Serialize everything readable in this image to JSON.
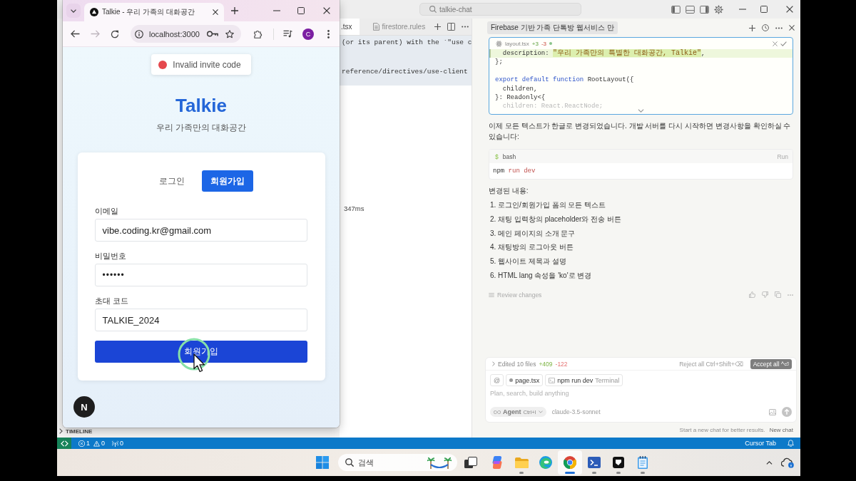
{
  "ide": {
    "command_center": {
      "label": "talkie-chat"
    },
    "sidebar": {
      "sections": [
        {
          "label": "TIMELINE",
          "expanded": false
        }
      ]
    },
    "editor": {
      "tabs": [
        {
          "label": ".tsx",
          "selected": true
        },
        {
          "label": "firestore.rules",
          "selected": false
        }
      ],
      "lines": [
        "(or its parent) with the `\"use c",
        "reference/directives/use-client"
      ],
      "timing": "347ms"
    },
    "chat": {
      "title": "Firebase 기반 가족 단톡방 웹서비스 만",
      "code_card": {
        "file": "layout.tsx",
        "added": "+3",
        "removed": "-3",
        "lines": [
          {
            "kind": "added",
            "tokens": [
              {
                "text": "  description: ",
                "kind": "plain"
              },
              {
                "text": "\"우리 가족만의 특별한 대화공간, Talkie\"",
                "kind": "string"
              },
              {
                "text": ",",
                "kind": "plain"
              }
            ]
          },
          {
            "kind": "context",
            "tokens": [
              {
                "text": "};",
                "kind": "plain"
              }
            ]
          },
          {
            "kind": "blank"
          },
          {
            "kind": "context",
            "tokens": [
              {
                "text": "export default function",
                "kind": "keyword"
              },
              {
                "text": " RootLayout({",
                "kind": "plain"
              }
            ]
          },
          {
            "kind": "context",
            "tokens": [
              {
                "text": "  children,",
                "kind": "plain"
              }
            ]
          },
          {
            "kind": "context",
            "tokens": [
              {
                "text": "}: Readonly<{",
                "kind": "plain"
              }
            ]
          },
          {
            "kind": "context",
            "tokens": [
              {
                "text": "  children: React.ReactNode;",
                "kind": "plain"
              }
            ]
          }
        ]
      },
      "message": "이제 모든 텍스트가 한글로 변경되었습니다. 개발 서버를 다시 시작하면 변경사항을 확인하실 수 있습니다:",
      "command": {
        "prompt": "$",
        "shell": "bash",
        "action": "Run",
        "tokens": [
          {
            "text": "npm",
            "kind": "plain"
          },
          {
            "text": " run dev",
            "kind": "string"
          }
        ]
      },
      "changes_heading": "변경된 내용:",
      "changes": [
        "1. 로그인/회원가입 폼의 모든 텍스트",
        "2. 채팅 입력창의 placeholder와 전송 버튼",
        "3. 메인 페이지의 소개 문구",
        "4. 채팅방의 로그아웃 버튼",
        "5. 웹사이트 제목과 설명",
        "6. HTML lang 속성을 'ko'로 변경"
      ],
      "review": "Review changes",
      "composer": {
        "summary": "Edited 10 files",
        "added": "+409",
        "removed": "-122",
        "reject": "Reject all Ctrl+Shift+⌫",
        "accept": "Accept all ^⏎",
        "chips": [
          {
            "kind": "mention",
            "label": "@"
          },
          {
            "kind": "file",
            "label": "page.tsx"
          },
          {
            "kind": "terminal",
            "label": "npm run dev",
            "detail": "Terminal"
          }
        ],
        "placeholder": "Plan, search, build anything",
        "mode": {
          "label": "Agent",
          "shortcut": "Ctrl+I"
        },
        "model": "claude-3.5-sonnet"
      },
      "hint": "Start a new chat for better results.",
      "new_chat": "New chat"
    },
    "status_bar": {
      "errors": "1",
      "warnings": "0",
      "ports": "0",
      "right": "Cursor Tab"
    }
  },
  "browser": {
    "tab": {
      "title": "Talkie - 우리 가족의 대화공간",
      "selected": true
    },
    "nav_buttons": [
      {
        "kind": "back",
        "disabled": false
      },
      {
        "kind": "forward",
        "disabled": true
      },
      {
        "kind": "reload",
        "disabled": false
      }
    ],
    "address": "localhost:3000",
    "profile_initial": "C",
    "page": {
      "toast": {
        "text": "Invalid invite code",
        "kind": "error"
      },
      "title": "Talkie",
      "subtitle": "우리 가족만의 대화공간",
      "tabs": [
        {
          "label": "로그인",
          "selected": false
        },
        {
          "label": "회원가입",
          "selected": true
        }
      ],
      "fields": [
        {
          "label": "이메일",
          "value": "vibe.coding.kr@gmail.com",
          "kind": "text"
        },
        {
          "label": "비밀번호",
          "value": "••••••",
          "kind": "password"
        },
        {
          "label": "초대 코드",
          "value": "TALKIE_2024",
          "kind": "text"
        }
      ],
      "submit": "회원가입",
      "dev_badge": "N"
    }
  },
  "taskbar": {
    "search": {
      "placeholder": "검색"
    },
    "apps": [
      {
        "kind": "task-view",
        "selected": false,
        "running": false
      },
      {
        "kind": "copilot",
        "selected": false,
        "running": false
      },
      {
        "kind": "explorer",
        "selected": false,
        "running": true
      },
      {
        "kind": "edge",
        "selected": false,
        "running": false
      },
      {
        "kind": "chrome",
        "selected": true,
        "running": true
      },
      {
        "kind": "terminal",
        "selected": false,
        "running": true
      },
      {
        "kind": "app",
        "selected": false,
        "running": true
      },
      {
        "kind": "notepad",
        "selected": false,
        "running": true
      }
    ]
  }
}
